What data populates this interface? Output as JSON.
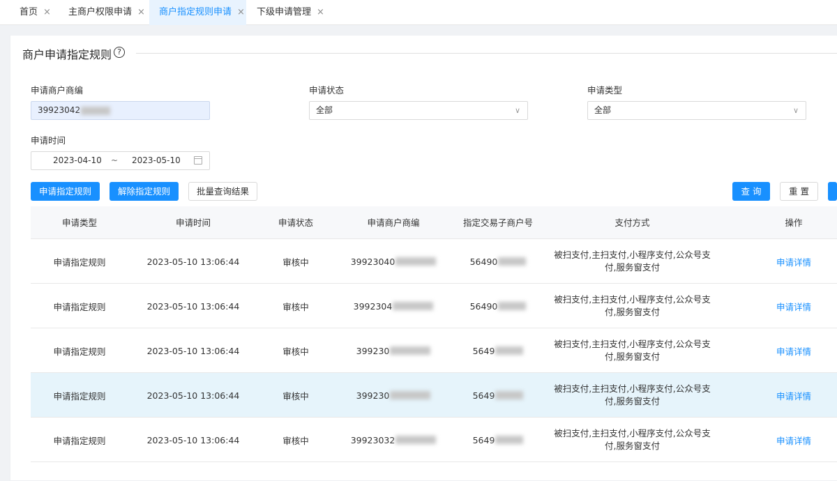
{
  "tabs": [
    {
      "label": "首页",
      "active": false
    },
    {
      "label": "主商户权限申请",
      "active": false
    },
    {
      "label": "商户指定规则申请",
      "active": true
    },
    {
      "label": "下级申请管理",
      "active": false
    }
  ],
  "tab_close_glyph": "×",
  "page": {
    "title": "商户申请指定规则",
    "help_glyph": "?"
  },
  "filters": {
    "merchant_no_label": "申请商户商编",
    "merchant_no_value": "39923042",
    "status_label": "申请状态",
    "status_value": "全部",
    "type_label": "申请类型",
    "type_value": "全部",
    "time_label": "申请时间",
    "date_start": "2023-04-10",
    "date_sep": "~",
    "date_end": "2023-05-10",
    "chevron_glyph": "∨"
  },
  "actions": {
    "apply_rule": "申请指定规则",
    "release_rule": "解除指定规则",
    "batch_query_result": "批量查询结果",
    "query": "查 询",
    "reset": "重 置"
  },
  "table": {
    "columns": [
      "申请类型",
      "申请时间",
      "申请状态",
      "申请商户商编",
      "指定交易子商户号",
      "支付方式",
      "操作"
    ],
    "rows": [
      {
        "type": "申请指定规则",
        "time": "2023-05-10 13:06:44",
        "status": "审核中",
        "merchant_no": "39923040",
        "sub_merchant_no": "56490",
        "pay_method": "被扫支付,主扫支付,小程序支付,公众号支付,服务窗支付",
        "action": "申请详情"
      },
      {
        "type": "申请指定规则",
        "time": "2023-05-10 13:06:44",
        "status": "审核中",
        "merchant_no": "3992304",
        "sub_merchant_no": "56490",
        "pay_method": "被扫支付,主扫支付,小程序支付,公众号支付,服务窗支付",
        "action": "申请详情"
      },
      {
        "type": "申请指定规则",
        "time": "2023-05-10 13:06:44",
        "status": "审核中",
        "merchant_no": "399230",
        "sub_merchant_no": "5649",
        "pay_method": "被扫支付,主扫支付,小程序支付,公众号支付,服务窗支付",
        "action": "申请详情"
      },
      {
        "type": "申请指定规则",
        "time": "2023-05-10 13:06:44",
        "status": "审核中",
        "merchant_no": "399230",
        "sub_merchant_no": "5649",
        "pay_method": "被扫支付,主扫支付,小程序支付,公众号支付,服务窗支付",
        "action": "申请详情",
        "highlighted": true
      },
      {
        "type": "申请指定规则",
        "time": "2023-05-10 13:06:44",
        "status": "审核中",
        "merchant_no": "39923032",
        "sub_merchant_no": "5649",
        "pay_method": "被扫支付,主扫支付,小程序支付,公众号支付,服务窗支付",
        "action": "申请详情"
      }
    ]
  },
  "colors": {
    "primary": "#1890ff",
    "active_tab_bg": "#e8f3fe",
    "row_highlight": "#e6f4fb"
  }
}
